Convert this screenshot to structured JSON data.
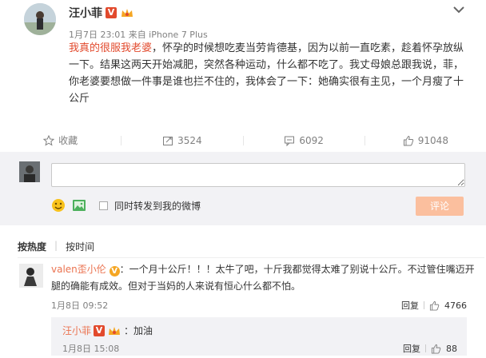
{
  "post": {
    "author": "汪小菲",
    "meta": "1月7日 23:01 来自 iPhone 7 Plus",
    "highlight": "我真的很服我老婆",
    "text_rest": "，怀孕的时候想吃麦当劳肯德基，因为以前一直吃素，趁着怀孕放纵一下。结果这两天开始减肥，突然各种运动，什么都不吃了。我丈母娘总跟我说，菲，你老婆要想做一件事是谁也拦不住的，我体会了一下：她确实很有主见，一个月瘦了十公斤"
  },
  "actions": {
    "favorite": "收藏",
    "repost": "3524",
    "comment": "6092",
    "like": "91048"
  },
  "composer": {
    "input_placeholder": "",
    "repost_checkbox": "同时转发到我的微博",
    "submit": "评论"
  },
  "sort": {
    "hot": "按热度",
    "time": "按时间"
  },
  "comment1": {
    "user": "valen歪小伦",
    "text": "：一个月十公斤！！！太牛了吧，十斤我都觉得太难了别说十公斤。不过管住嘴迈开腿的确能有成效。但对于当妈的人来说有恒心什么都不怕。",
    "time": "1月8日 09:52",
    "reply": "回复",
    "likes": "4766"
  },
  "reply1": {
    "user": "汪小菲",
    "text": "：加油",
    "time": "1月8日 15:08",
    "reply": "回复",
    "likes": "88"
  },
  "colors": {
    "accent": "#eb7350",
    "highlight": "#e24a2d",
    "submit_bg": "#fbbf9e",
    "panel_bg": "#f2f2f5"
  }
}
